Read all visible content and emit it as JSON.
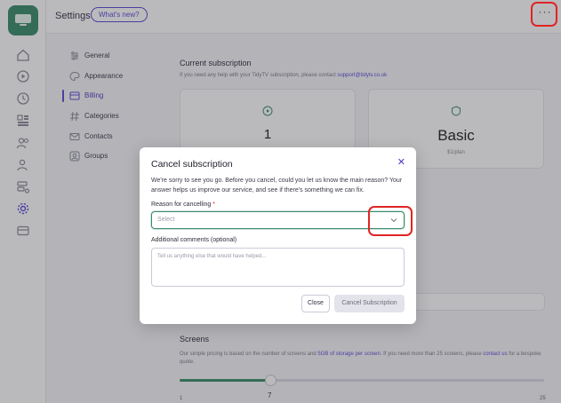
{
  "header": {
    "title": "Settings",
    "whats_new": "What's new?",
    "more_label": "···"
  },
  "settings_nav": {
    "items": [
      {
        "label": "General",
        "icon": "sliders-icon"
      },
      {
        "label": "Appearance",
        "icon": "palette-icon"
      },
      {
        "label": "Billing",
        "icon": "billing-icon",
        "active": true
      },
      {
        "label": "Categories",
        "icon": "hash-icon"
      },
      {
        "label": "Contacts",
        "icon": "mail-icon"
      },
      {
        "label": "Groups",
        "icon": "group-icon"
      }
    ]
  },
  "subscription": {
    "title": "Current subscription",
    "subtitle_prefix": "If you need any help with your TidyTV subscription, please contact",
    "support_email": "support@tidytv.co.uk",
    "card1_value": "1",
    "card2_value": "Basic",
    "card2_sub": "$1/plan"
  },
  "screens": {
    "title": "Screens",
    "desc_prefix": "Our simple pricing is based on the number of screens and",
    "desc_bold": "5GB of storage per screen",
    "desc_suffix": ". If you need more than 25 screens, please",
    "desc_link": "contact us",
    "desc_end": "for a bespoke quote.",
    "slider_value": "7",
    "slider_min": "1",
    "slider_max": "25",
    "slider_fraction": 0.25
  },
  "modal": {
    "title": "Cancel subscription",
    "close_glyph": "✕",
    "description": "We're sorry to see you go. Before you cancel, could you let us know the main reason? Your answer helps us improve our service, and see if there's something we can fix.",
    "reason_label": "Reason for cancelling",
    "required_mark": "*",
    "reason_placeholder": "Select",
    "comments_label": "Additional comments (optional)",
    "comments_placeholder": "Tell us anything else that would have helped...",
    "close_button": "Close",
    "cancel_button": "Cancel Subscription"
  },
  "colors": {
    "accent": "#5b4ad8",
    "brand": "#3a8c6a",
    "highlight": "#e02424"
  }
}
